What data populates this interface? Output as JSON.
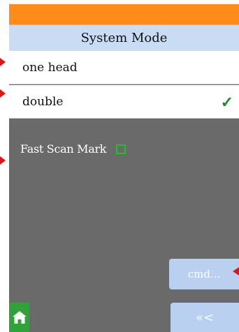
{
  "header": {
    "title": "System Mode"
  },
  "modes": [
    {
      "label": "one head",
      "selected": false
    },
    {
      "label": "double",
      "selected": true
    }
  ],
  "options": {
    "fast_scan_label": "Fast Scan Mark",
    "fast_scan_checked": false
  },
  "buttons": {
    "cmd_label": "cmd...",
    "back_label": "«<"
  },
  "icons": {
    "check": "✓",
    "home": "home-icon"
  },
  "colors": {
    "top_bar": "#ff8c1a",
    "header_bg": "#c9dcf4",
    "panel_bg": "#6a6a6a",
    "button_bg": "#b9d0f0",
    "home_bg": "#2fa33a",
    "check": "#1f8a2a",
    "checkbox_border": "#1ec31e",
    "pointer_arrows": "#e01515"
  }
}
